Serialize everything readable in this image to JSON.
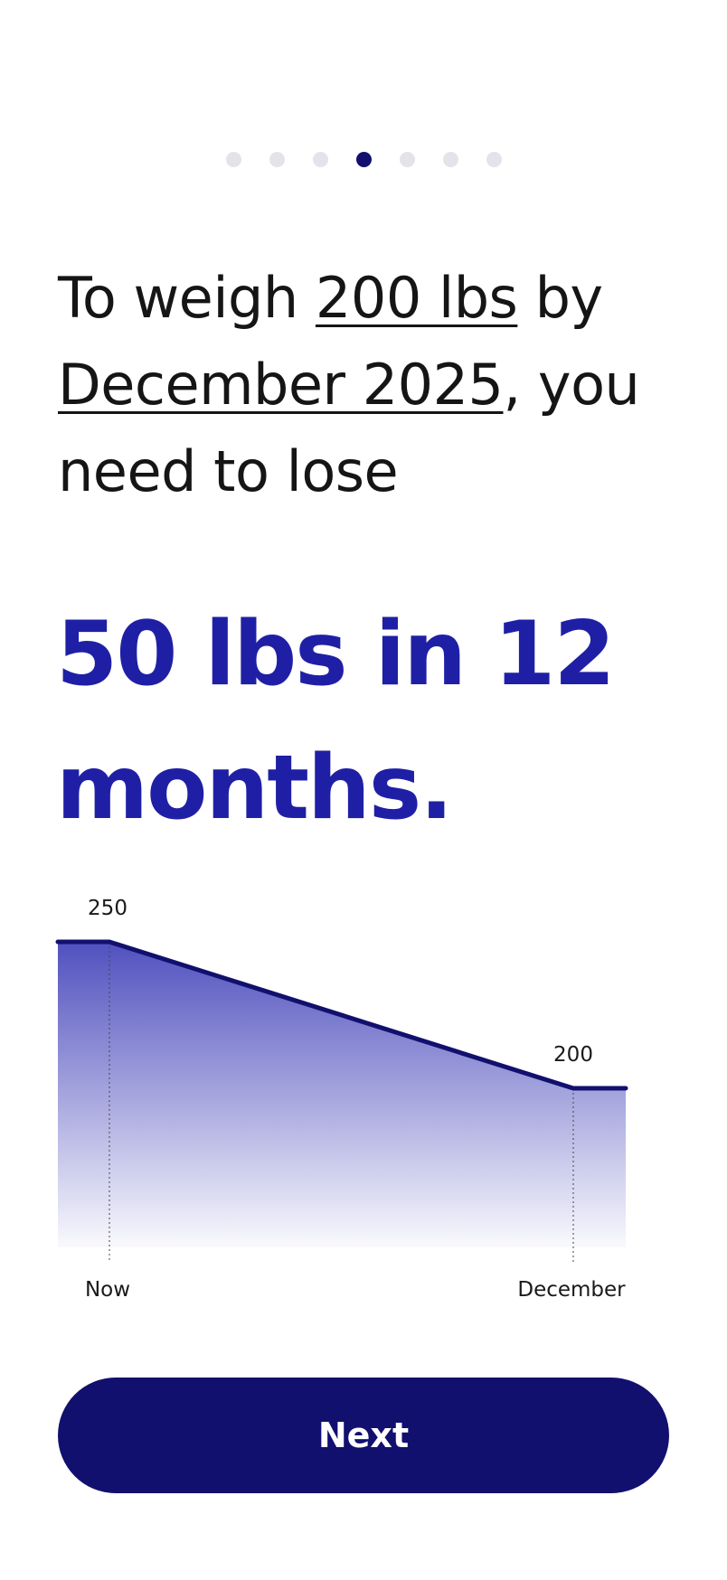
{
  "progress": {
    "total_steps": 7,
    "current_step": 4,
    "active_color": "#11106e",
    "inactive_color": "#e3e3ea"
  },
  "headline": {
    "part1": "To weigh ",
    "target_weight": "200 lbs",
    "part2": " by ",
    "target_date": "December 2025",
    "part3": ", you need to lose"
  },
  "result": {
    "text": "50 lbs in 12 months.",
    "color": "#1f1fa6"
  },
  "chart_data": {
    "type": "area",
    "x": [
      "Now",
      "December"
    ],
    "values": [
      250,
      200
    ],
    "start_label": "250",
    "end_label": "200",
    "xlabels": [
      "Now",
      "December"
    ],
    "line_color": "#11106e",
    "fill_color": "#3d3db8"
  },
  "actions": {
    "next_label": "Next"
  }
}
